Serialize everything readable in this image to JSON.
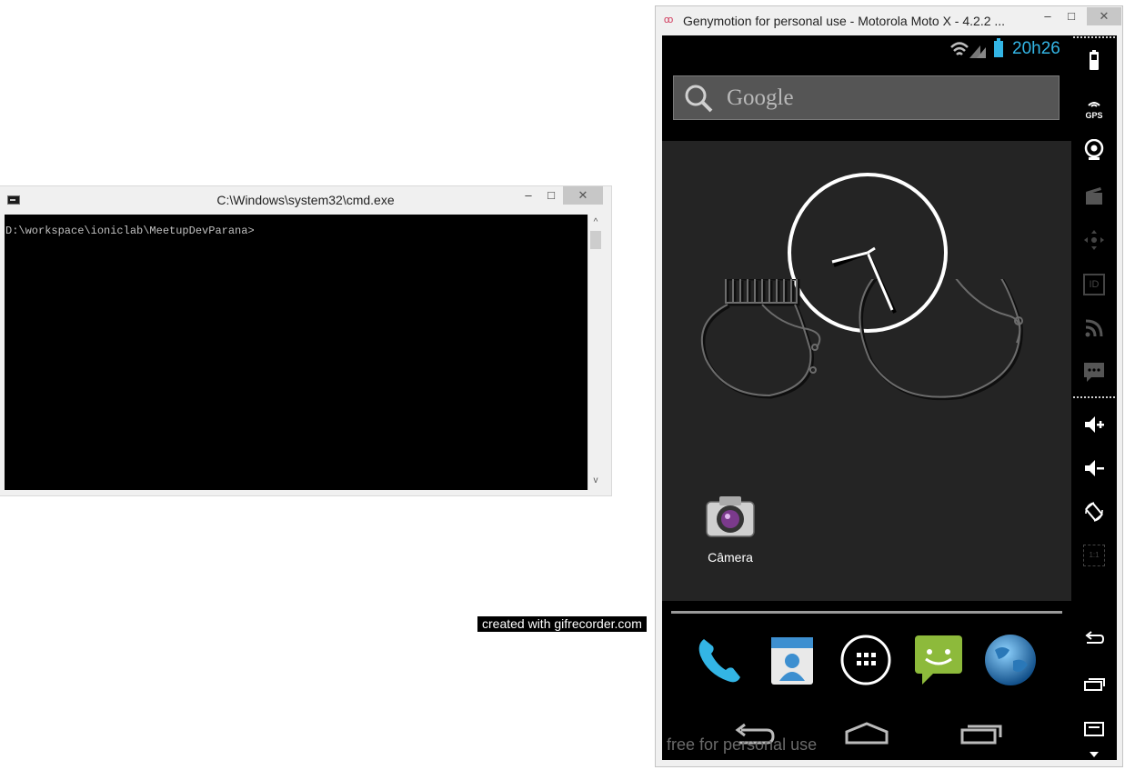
{
  "cmd": {
    "title": "C:\\Windows\\system32\\cmd.exe",
    "prompt": "D:\\workspace\\ioniclab\\MeetupDevParana>",
    "minimize_label": "–",
    "maximize_label": "□",
    "close_label": "✕",
    "scroll_up": "^",
    "scroll_down": "v"
  },
  "watermark": {
    "text": "created with gifrecorder.com"
  },
  "genymotion": {
    "title": "Genymotion for personal use - Motorola Moto X - 4.2.2 ...",
    "logo": "oo",
    "minimize_label": "–",
    "maximize_label": "□",
    "close_label": "✕",
    "free_text": "free for personal use",
    "status": {
      "time": "20h26"
    },
    "search": {
      "placeholder": "Google"
    },
    "home_apps": [
      {
        "label": "Câmera",
        "icon": "camera-icon"
      }
    ],
    "dock": [
      {
        "icon": "phone-icon"
      },
      {
        "icon": "contacts-icon"
      },
      {
        "icon": "all-apps-icon"
      },
      {
        "icon": "messaging-icon"
      },
      {
        "icon": "browser-icon"
      }
    ],
    "navbar": [
      "back-icon",
      "home-icon",
      "recent-apps-icon"
    ],
    "sidebar": {
      "gps_label": "GPS",
      "id_label": "ID",
      "scale_label": "1:1",
      "tools": [
        "battery-icon",
        "gps-icon",
        "camera-icon",
        "media-icon",
        "dpad-icon",
        "id-icon",
        "rss-icon",
        "sms-icon",
        "volume-up-icon",
        "volume-down-icon",
        "rotate-icon",
        "scale-icon",
        "back-icon",
        "recent-apps-icon",
        "menu-icon"
      ]
    }
  },
  "colors": {
    "android_blue": "#33b5e5",
    "cmd_bg": "#000000",
    "wallpaper": "#242424"
  }
}
